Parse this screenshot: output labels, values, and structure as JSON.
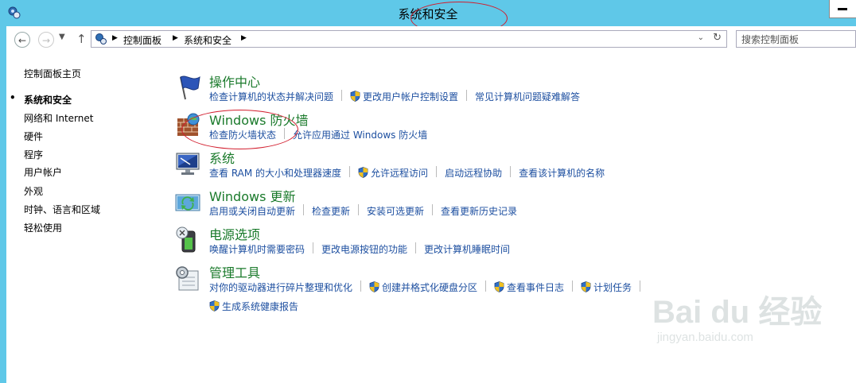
{
  "window": {
    "title": "系统和安全",
    "app_icon": "control-panel-icon",
    "minimize_icon": "minimize-icon"
  },
  "nav": {
    "back_icon": "back-arrow-icon",
    "forward_icon": "forward-arrow-icon",
    "recent_icon": "chevron-down-icon",
    "up_icon": "up-arrow-icon",
    "breadcrumbs": [
      "控制面板",
      "系统和安全"
    ],
    "refresh_icon": "refresh-icon",
    "search_placeholder": "搜索控制面板"
  },
  "sidebar": {
    "home": "控制面板主页",
    "items": [
      {
        "label": "系统和安全",
        "current": true
      },
      {
        "label": "网络和 Internet"
      },
      {
        "label": "硬件"
      },
      {
        "label": "程序"
      },
      {
        "label": "用户帐户"
      },
      {
        "label": "外观"
      },
      {
        "label": "时钟、语言和区域"
      },
      {
        "label": "轻松使用"
      }
    ]
  },
  "categories": [
    {
      "title": "操作中心",
      "icon": "action-center-flag-icon",
      "links": [
        {
          "label": "检查计算机的状态并解决问题"
        },
        {
          "label": "更改用户帐户控制设置",
          "shield": true
        },
        {
          "label": "常见计算机问题疑难解答"
        }
      ]
    },
    {
      "title": "Windows 防火墙",
      "icon": "firewall-icon",
      "links": [
        {
          "label": "检查防火墙状态"
        },
        {
          "label": "允许应用通过 Windows 防火墙"
        }
      ]
    },
    {
      "title": "系统",
      "icon": "system-monitor-icon",
      "links": [
        {
          "label": "查看 RAM 的大小和处理器速度"
        },
        {
          "label": "允许远程访问",
          "shield": true
        },
        {
          "label": "启动远程协助"
        },
        {
          "label": "查看该计算机的名称"
        }
      ]
    },
    {
      "title": "Windows 更新",
      "icon": "windows-update-icon",
      "links": [
        {
          "label": "启用或关闭自动更新"
        },
        {
          "label": "检查更新"
        },
        {
          "label": "安装可选更新"
        },
        {
          "label": "查看更新历史记录"
        }
      ]
    },
    {
      "title": "电源选项",
      "icon": "power-options-icon",
      "links": [
        {
          "label": "唤醒计算机时需要密码"
        },
        {
          "label": "更改电源按钮的功能"
        },
        {
          "label": "更改计算机睡眠时间"
        }
      ]
    },
    {
      "title": "管理工具",
      "icon": "admin-tools-icon",
      "links": [
        {
          "label": "对你的驱动器进行碎片整理和优化"
        },
        {
          "label": "创建并格式化硬盘分区",
          "shield": true
        },
        {
          "label": "查看事件日志",
          "shield": true
        },
        {
          "label": "计划任务",
          "shield": true
        }
      ],
      "links2": [
        {
          "label": "生成系统健康报告",
          "shield": true
        }
      ]
    }
  ],
  "watermark": {
    "logo": "Bai du 经验",
    "url": "jingyan.baidu.com"
  },
  "colors": {
    "titlebar": "#5fc8e8",
    "category_title": "#1a7a2b",
    "link": "#1d4fa0",
    "annotation_circle": "#d21e2e"
  }
}
